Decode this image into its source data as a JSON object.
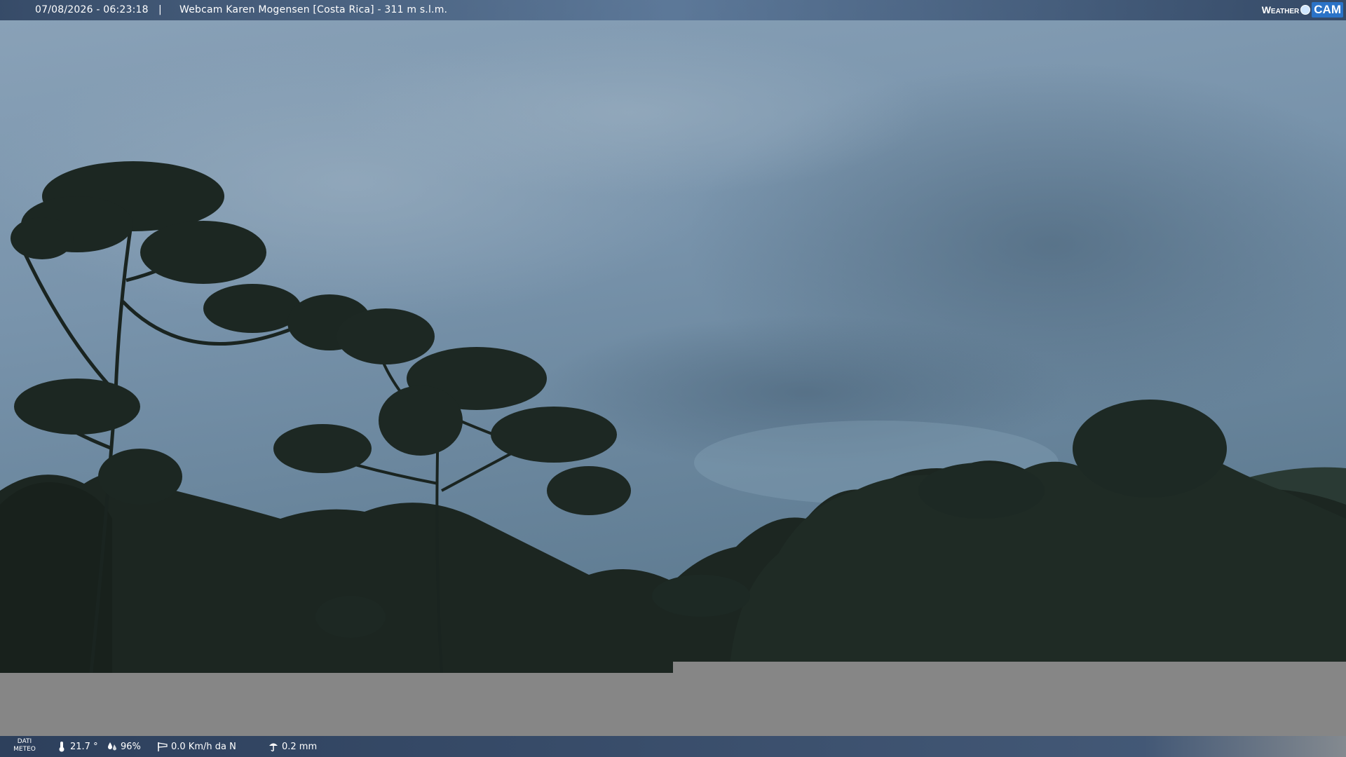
{
  "header": {
    "datetime": "07/08/2026 - 06:23:18",
    "separator": "|",
    "title": "Webcam Karen Mogensen [Costa Rica]  - 311 m s.l.m.",
    "logo_weather": "Weather",
    "logo_cam": "CAM"
  },
  "weather": {
    "label_line1": "DATI",
    "label_line2": "METEO",
    "temperature": "21.7 °",
    "humidity": "96%",
    "wind": "0.0 Km/h da N",
    "rain": "0.2 mm"
  },
  "colors": {
    "sky_top": "#7f9bb3",
    "sky_bottom": "#5f7a92",
    "foliage": "#1e2a24",
    "gray_panel": "#868686",
    "bar": "#34506f"
  }
}
